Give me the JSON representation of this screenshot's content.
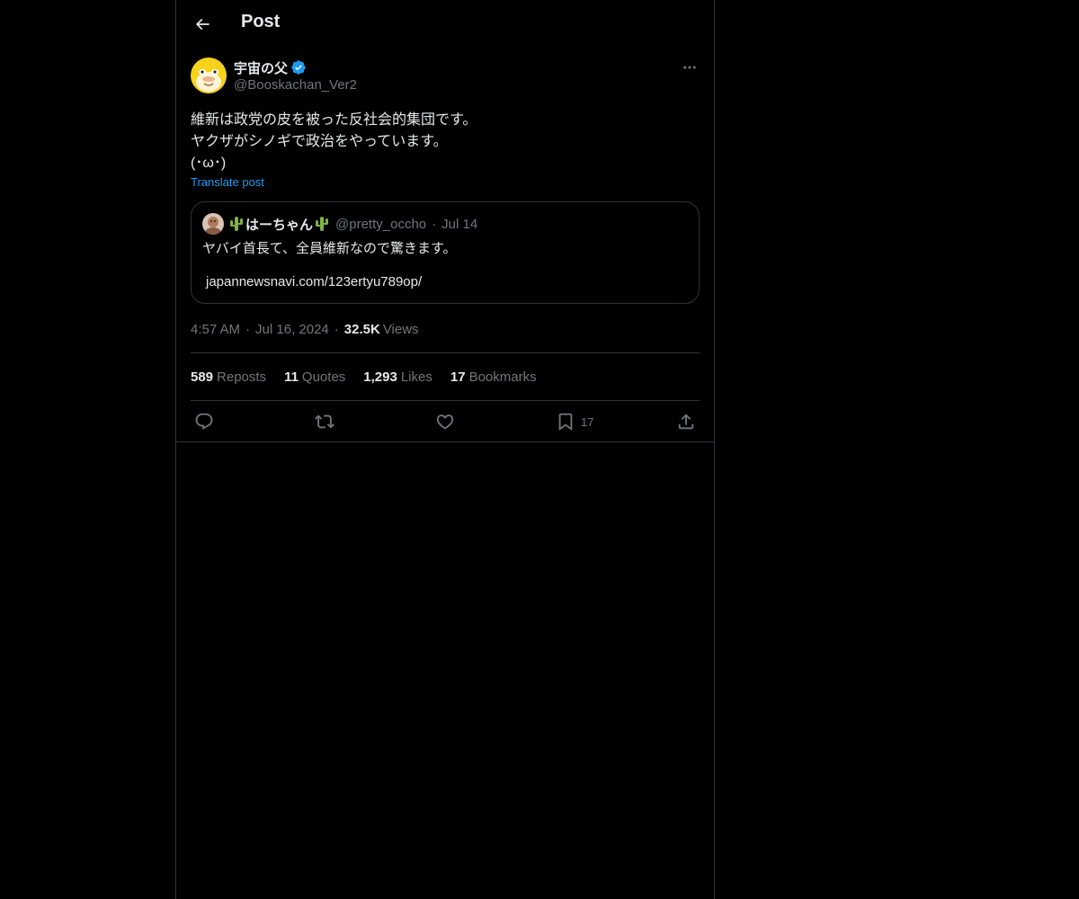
{
  "header": {
    "title": "Post"
  },
  "post": {
    "author": {
      "display_name": "宇宙の父",
      "handle": "@Booskachan_Ver2",
      "verified": true
    },
    "text_lines": [
      "維新は政党の皮を被った反社会的集団です。",
      "ヤクザがシノギで政治をやっています。",
      "(･ω･)"
    ],
    "translate_label": "Translate post",
    "quote": {
      "display_name": "はーちゃん",
      "handle": "@pretty_occho",
      "separator": "·",
      "date": "Jul 14",
      "text": "ヤバイ首長て、全員維新なので驚きます。",
      "link": "japannewsnavi.com/123ertyu789op/"
    },
    "time": "4:57 AM",
    "date": "Jul 16, 2024",
    "separator": "·",
    "views_count": "32.5K",
    "views_label": "Views"
  },
  "stats": {
    "reposts": {
      "count": "589",
      "label": "Reposts"
    },
    "quotes": {
      "count": "11",
      "label": "Quotes"
    },
    "likes": {
      "count": "1,293",
      "label": "Likes"
    },
    "bookmarks": {
      "count": "17",
      "label": "Bookmarks"
    }
  },
  "actions": {
    "bookmark_count": "17"
  },
  "colors": {
    "background": "#000000",
    "text": "#e7e9ea",
    "muted": "#71767b",
    "accent": "#1d9bf0",
    "border": "#2f3336"
  },
  "icons": {
    "back": "arrow-left-icon",
    "more": "more-horizontal-icon",
    "verified": "verified-badge-icon",
    "reply": "reply-icon",
    "repost": "repost-icon",
    "like": "heart-icon",
    "bookmark": "bookmark-icon",
    "share": "share-icon"
  }
}
